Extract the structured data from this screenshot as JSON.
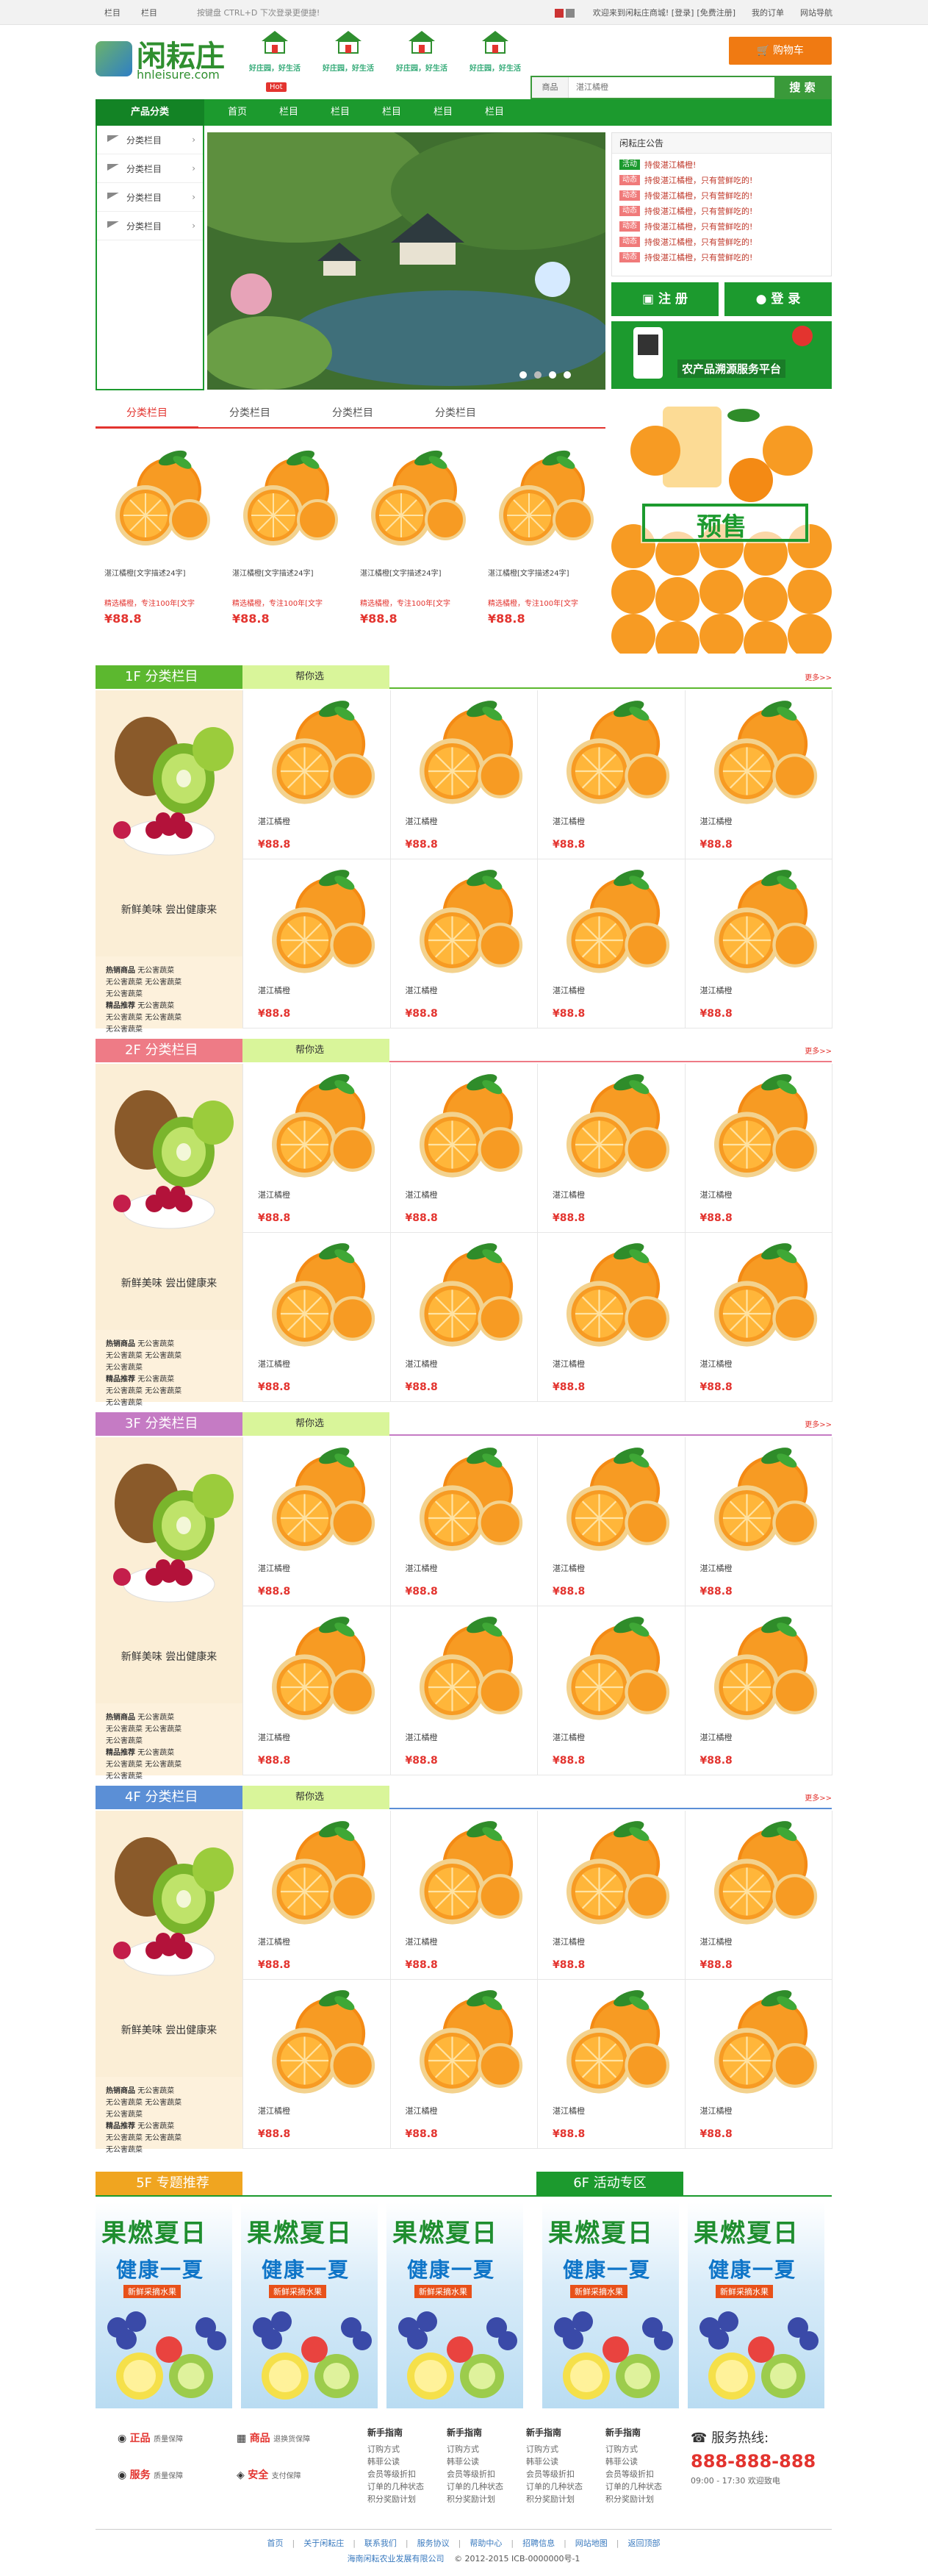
{
  "topbar": {
    "left_links": [
      "栏目",
      "栏目"
    ],
    "tip": "按键盘 CTRL+D 下次登录更便捷!",
    "right_links": [
      "欢迎来到闲耘庄商城! [登录]",
      "[免费注册]",
      "我的订单",
      "网站导航"
    ]
  },
  "logo": {
    "title": "闲耘庄",
    "subtitle": "hnleisure.com"
  },
  "badges": [
    "好庄园，好生活",
    "好庄园，好生活",
    "好庄园，好生活",
    "好庄园，好生活"
  ],
  "hot_label": "Hot",
  "cart_label": "购物车",
  "search": {
    "category": "商品",
    "placeholder": "湛江橘橙",
    "button": "搜 索"
  },
  "nav": {
    "category_label": "产品分类",
    "items": [
      "首页",
      "栏目",
      "栏目",
      "栏目",
      "栏目",
      "栏目"
    ]
  },
  "sidecat": [
    "分类栏目",
    "分类栏目",
    "分类栏目",
    "分类栏目"
  ],
  "notice": {
    "title": "闲耘庄公告",
    "items": [
      {
        "tag": "活动",
        "text": "持俊湛江橘橙!"
      },
      {
        "tag": "动态",
        "text": "持俊湛江橘橙，只有营鲜吃的!"
      },
      {
        "tag": "动态",
        "text": "持俊湛江橘橙，只有营鲜吃的!"
      },
      {
        "tag": "动态",
        "text": "持俊湛江橘橙，只有营鲜吃的!"
      },
      {
        "tag": "动态",
        "text": "持俊湛江橘橙，只有营鲜吃的!"
      },
      {
        "tag": "动态",
        "text": "持俊湛江橘橙，只有营鲜吃的!"
      },
      {
        "tag": "动态",
        "text": "持俊湛江橘橙，只有营鲜吃的!"
      }
    ]
  },
  "buttons": {
    "register": "注 册",
    "login": "登 录"
  },
  "trace_banner": "农产品溯源服务平台",
  "presale_label": "预售",
  "tabs": [
    "分类栏目",
    "分类栏目",
    "分类栏目",
    "分类栏目"
  ],
  "featured": [
    {
      "name": "湛江橘橙[文字描述24字]",
      "sub": "精选橘橙，专注100年[文字",
      "price": "¥88.8"
    },
    {
      "name": "湛江橘橙[文字描述24字]",
      "sub": "精选橘橙，专注100年[文字",
      "price": "¥88.8"
    },
    {
      "name": "湛江橘橙[文字描述24字]",
      "sub": "精选橘橙，专注100年[文字",
      "price": "¥88.8"
    },
    {
      "name": "湛江橘橙[文字描述24字]",
      "sub": "精选橘橙，专注100年[文字",
      "price": "¥88.8"
    }
  ],
  "floors": [
    {
      "label": "1F 分类栏目",
      "color": "#5cb82f"
    },
    {
      "label": "2F 分类栏目",
      "color": "#ee7b86"
    },
    {
      "label": "3F 分类栏目",
      "color": "#c57bc4"
    },
    {
      "label": "4F 分类栏目",
      "color": "#5b8fd6"
    }
  ],
  "floor_common": {
    "help": "帮你选",
    "more": "更多>>",
    "slogan": "新鲜美味 尝出健康来",
    "tags_hot_label": "热销商品",
    "tags_fine_label": "精品推荐",
    "tags_text": "无公害蔬菜",
    "product_name": "湛江橘橙",
    "product_price": "¥88.8"
  },
  "special": {
    "left_title": "5F 专题推荐",
    "right_title": "6F 活动专区",
    "banner_t1": "果燃夏日",
    "banner_t2": "健康一夏",
    "banner_t3": "新鲜采摘水果"
  },
  "footer": {
    "svc": [
      {
        "big": "正品",
        "small": "质量保障"
      },
      {
        "big": "商品",
        "small": "退换货保障"
      },
      {
        "big": "服务",
        "small": "质量保障"
      },
      {
        "big": "安全",
        "small": "支付保障"
      }
    ],
    "columns": [
      {
        "title": "新手指南",
        "links": [
          "订购方式",
          "韩菲公读",
          "会员等级折扣",
          "订单的几种状态",
          "积分奖励计划"
        ]
      },
      {
        "title": "新手指南",
        "links": [
          "订购方式",
          "韩菲公读",
          "会员等级折扣",
          "订单的几种状态",
          "积分奖励计划"
        ]
      },
      {
        "title": "新手指南",
        "links": [
          "订购方式",
          "韩菲公读",
          "会员等级折扣",
          "订单的几种状态",
          "积分奖励计划"
        ]
      },
      {
        "title": "新手指南",
        "links": [
          "订购方式",
          "韩菲公读",
          "会员等级折扣",
          "订单的几种状态",
          "积分奖励计划"
        ]
      }
    ],
    "hotline_label": "服务热线:",
    "hotline_number": "888-888-888",
    "hotline_hours": "09:00 - 17:30 欢迎致电",
    "links": [
      "首页",
      "关于闲耘庄",
      "联系我们",
      "服务协议",
      "帮助中心",
      "招聘信息",
      "网站地图",
      "返回顶部"
    ],
    "company": "海南闲耘农业发展有限公司",
    "copyright": "© 2012-2015   ICB-0000000号-1"
  }
}
